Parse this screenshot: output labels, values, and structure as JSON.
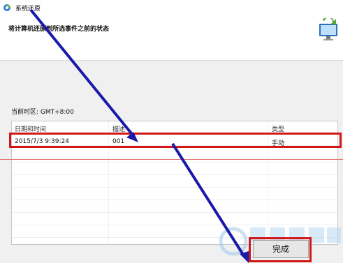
{
  "window": {
    "title": "系统还原"
  },
  "heading": "将计算机还原到所选事件之前的状态",
  "timezone": "当前时区: GMT+8:00",
  "table": {
    "columns": [
      "日期和时间",
      "描述",
      "类型"
    ],
    "rows": [
      {
        "datetime": "2015/7/3 9:39:24",
        "description": "001",
        "type": "手动"
      }
    ]
  },
  "buttons": {
    "finish": "完成"
  },
  "colors": {
    "annotation_blue": "#1a1aa8",
    "annotation_red": "#d01818"
  },
  "icons": {
    "title": "system-restore-icon",
    "header": "system-restore-monitor-icon"
  }
}
